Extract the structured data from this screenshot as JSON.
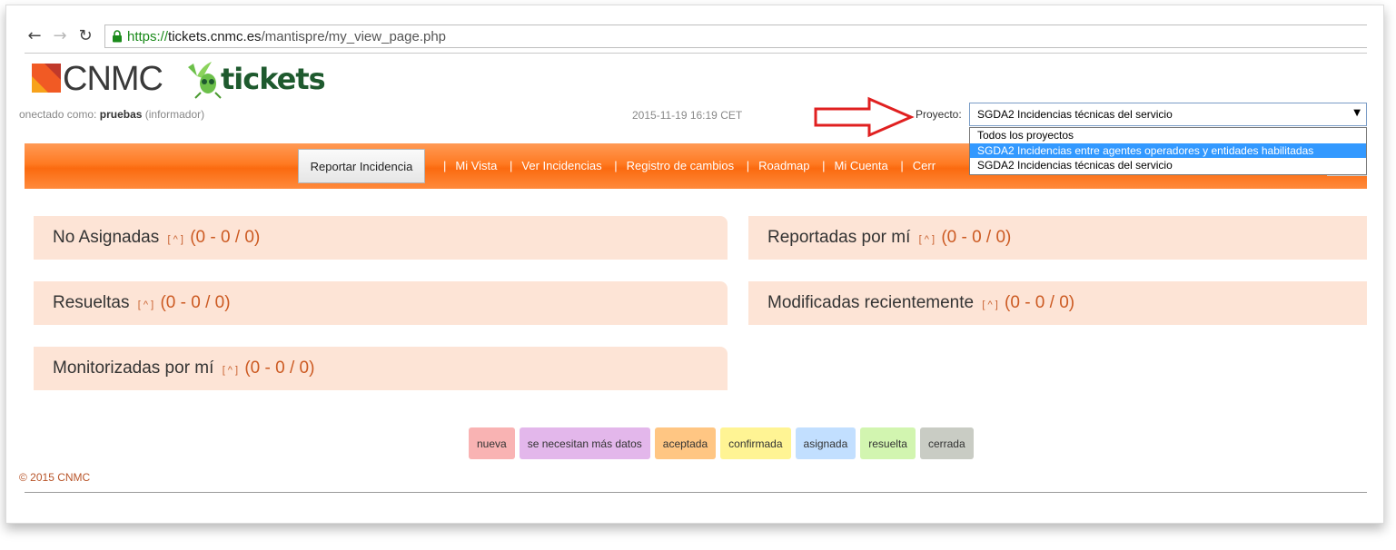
{
  "browser": {
    "url_scheme": "https://",
    "url_host": "tickets.cnmc.es",
    "url_path": "/mantispre/my_view_page.php"
  },
  "logos": {
    "cnmc": "CNMC",
    "tickets": "tickets"
  },
  "header": {
    "login_prefix": "onectado como:",
    "username": "pruebas",
    "role": "(informador)",
    "datetime": "2015-11-19 16:19 CET",
    "project_label": "Proyecto:",
    "project_selected": "SGDA2 Incidencias técnicas del servicio",
    "project_options": [
      "Todos los proyectos",
      "SGDA2 Incidencias entre agentes operadores y entidades habilitadas",
      "SGDA2 Incidencias técnicas del servicio"
    ]
  },
  "menu": {
    "report_button": "Reportar Incidencia",
    "items": [
      "Mi Vista",
      "Ver Incidencias",
      "Registro de cambios",
      "Roadmap",
      "Mi Cuenta",
      "Cerr"
    ],
    "separator": "|"
  },
  "panels": {
    "caret": "[ ^ ]",
    "items": [
      {
        "title": "No Asignadas",
        "count": "(0 - 0 / 0)"
      },
      {
        "title": "Reportadas por mí",
        "count": "(0 - 0 / 0)"
      },
      {
        "title": "Resueltas",
        "count": "(0 - 0 / 0)"
      },
      {
        "title": "Modificadas recientemente",
        "count": "(0 - 0 / 0)"
      },
      {
        "title": "Monitorizadas por mí",
        "count": "(0 - 0 / 0)"
      }
    ]
  },
  "legend": [
    {
      "label": "nueva",
      "color": "#f9b3b3"
    },
    {
      "label": "se necesitan más datos",
      "color": "#e3b7eb"
    },
    {
      "label": "aceptada",
      "color": "#ffc683"
    },
    {
      "label": "confirmada",
      "color": "#fff494"
    },
    {
      "label": "asignada",
      "color": "#c2dfff"
    },
    {
      "label": "resuelta",
      "color": "#d2f5b0"
    },
    {
      "label": "cerrada",
      "color": "#c9ccc4"
    }
  ],
  "footer": {
    "copyright": "© 2015 CNMC"
  },
  "colors": {
    "menu_orange": "#ff7a22",
    "panel_bg": "#fde4d6",
    "accent_text": "#cc5a22",
    "arrow_red": "#e02020"
  }
}
